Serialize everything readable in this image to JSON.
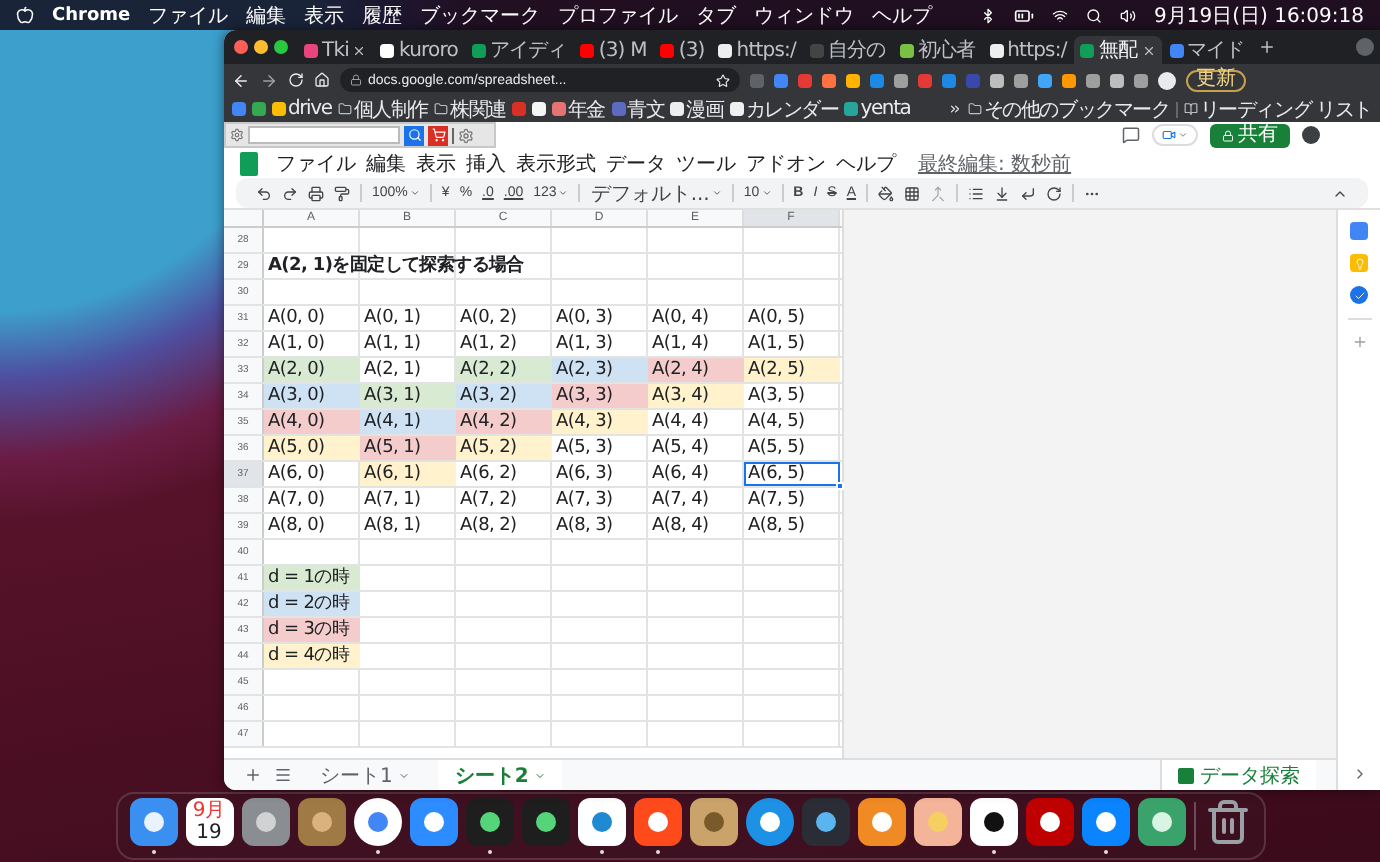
{
  "menubar": {
    "app": "Chrome",
    "menus": [
      "ファイル",
      "編集",
      "表示",
      "履歴",
      "ブックマーク",
      "プロファイル",
      "タブ",
      "ウィンドウ",
      "ヘルプ"
    ],
    "clock": "9月19日(日) 16:09:18"
  },
  "browser": {
    "tabs": [
      {
        "title": "Tki",
        "selected": false,
        "closable": true,
        "color": "#e8457c"
      },
      {
        "title": "kuroro",
        "selected": false,
        "closable": false,
        "color": "#ffffff"
      },
      {
        "title": "アイディ",
        "selected": false,
        "closable": false,
        "color": "#0f9d58"
      },
      {
        "title": "(3) M",
        "selected": false,
        "closable": false,
        "color": "#ff0000"
      },
      {
        "title": "(3)",
        "selected": false,
        "closable": false,
        "color": "#ff0000"
      },
      {
        "title": "https:/",
        "selected": false,
        "closable": false,
        "color": "#eeeeee"
      },
      {
        "title": "自分の",
        "selected": false,
        "closable": false,
        "color": "#444444"
      },
      {
        "title": "初心者",
        "selected": false,
        "closable": false,
        "color": "#7ac143"
      },
      {
        "title": "https:/",
        "selected": false,
        "closable": false,
        "color": "#eeeeee"
      },
      {
        "title": "無配",
        "selected": true,
        "closable": true,
        "color": "#0f9d58"
      },
      {
        "title": "マイド",
        "selected": false,
        "closable": false,
        "color": "#4285f4"
      }
    ],
    "address": "docs.google.com/spreadsheet...",
    "update_button": "更新",
    "bookmarks": [
      {
        "kind": "icon",
        "color": "#4285f4"
      },
      {
        "kind": "icon",
        "color": "#34a853"
      },
      {
        "kind": "link",
        "label": "drive",
        "color": "#fbbc04"
      },
      {
        "kind": "folder",
        "label": "個人制作"
      },
      {
        "kind": "folder",
        "label": "株関連"
      },
      {
        "kind": "icon",
        "color": "#d93025"
      },
      {
        "kind": "icon",
        "color": "#f5f5f5"
      },
      {
        "kind": "link",
        "label": "年金",
        "color": "#e57373"
      },
      {
        "kind": "link",
        "label": "青文",
        "color": "#5c6bc0"
      },
      {
        "kind": "link",
        "label": "漫画",
        "color": "#eeeeee"
      },
      {
        "kind": "link",
        "label": "カレンダー",
        "color": "#f0f0f0"
      },
      {
        "kind": "link",
        "label": "yenta",
        "color": "#26a69a"
      }
    ],
    "other_bookmarks": "その他のブックマーク",
    "reading_list": "リーディング リスト"
  },
  "sheet": {
    "menus": [
      "ファイル",
      "編集",
      "表示",
      "挿入",
      "表示形式",
      "データ",
      "ツール",
      "アドオン",
      "ヘルプ"
    ],
    "last_edit": "最終編集: 数秒前",
    "share_button": "共有",
    "toolbar": {
      "zoom": "100%",
      "currency": "¥",
      "percent": "%",
      "decrease_decimals": ".0",
      "increase_decimals": ".00",
      "number_format": "123",
      "font": "デフォルト...",
      "font_size": "10",
      "bold": "B",
      "italic": "I",
      "strikethrough": "S",
      "text_color": "A"
    },
    "columns": [
      "A",
      "B",
      "C",
      "D",
      "E",
      "F"
    ],
    "rows": [
      {
        "number": "28"
      },
      {
        "number": "29",
        "cells": [
          {
            "text": "A(2, 1)を固定して探索する場合",
            "bold": true,
            "selected": false
          }
        ]
      },
      {
        "number": "30"
      },
      {
        "number": "31",
        "cells": [
          {
            "text": "A(0, 0)",
            "selected": false
          },
          {
            "text": "A(0, 1)",
            "selected": false
          },
          {
            "text": "A(0, 2)",
            "selected": false
          },
          {
            "text": "A(0, 3)",
            "selected": false
          },
          {
            "text": "A(0, 4)",
            "selected": false
          },
          {
            "text": "A(0, 5)",
            "selected": false
          }
        ]
      },
      {
        "number": "32",
        "cells": [
          {
            "text": "A(1, 0)",
            "selected": false
          },
          {
            "text": "A(1, 1)",
            "selected": false
          },
          {
            "text": "A(1, 2)",
            "selected": false
          },
          {
            "text": "A(1, 3)",
            "selected": false
          },
          {
            "text": "A(1, 4)",
            "selected": false
          },
          {
            "text": "A(1, 5)",
            "selected": false
          }
        ]
      },
      {
        "number": "33",
        "cells": [
          {
            "text": "A(2, 0)",
            "color": "#d9ead3",
            "selected": false
          },
          {
            "text": "A(2, 1)",
            "selected": false
          },
          {
            "text": "A(2, 2)",
            "color": "#d9ead3",
            "selected": false
          },
          {
            "text": "A(2, 3)",
            "color": "#cfe2f3",
            "selected": false
          },
          {
            "text": "A(2, 4)",
            "color": "#f4cccc",
            "selected": false
          },
          {
            "text": "A(2, 5)",
            "color": "#fff2cc",
            "selected": false
          }
        ]
      },
      {
        "number": "34",
        "cells": [
          {
            "text": "A(3, 0)",
            "color": "#cfe2f3",
            "selected": false
          },
          {
            "text": "A(3, 1)",
            "color": "#d9ead3",
            "selected": false
          },
          {
            "text": "A(3, 2)",
            "color": "#cfe2f3",
            "selected": false
          },
          {
            "text": "A(3, 3)",
            "color": "#f4cccc",
            "selected": false
          },
          {
            "text": "A(3, 4)",
            "color": "#fff2cc",
            "selected": false
          },
          {
            "text": "A(3, 5)",
            "selected": false
          }
        ]
      },
      {
        "number": "35",
        "cells": [
          {
            "text": "A(4, 0)",
            "color": "#f4cccc",
            "selected": false
          },
          {
            "text": "A(4, 1)",
            "color": "#cfe2f3",
            "selected": false
          },
          {
            "text": "A(4, 2)",
            "color": "#f4cccc",
            "selected": false
          },
          {
            "text": "A(4, 3)",
            "color": "#fff2cc",
            "selected": false
          },
          {
            "text": "A(4, 4)",
            "selected": false
          },
          {
            "text": "A(4, 5)",
            "selected": false
          }
        ]
      },
      {
        "number": "36",
        "cells": [
          {
            "text": "A(5, 0)",
            "color": "#fff2cc",
            "selected": false
          },
          {
            "text": "A(5, 1)",
            "color": "#f4cccc",
            "selected": false
          },
          {
            "text": "A(5, 2)",
            "color": "#fff2cc",
            "selected": false
          },
          {
            "text": "A(5, 3)",
            "selected": false
          },
          {
            "text": "A(5, 4)",
            "selected": false
          },
          {
            "text": "A(5, 5)",
            "selected": false
          }
        ]
      },
      {
        "number": "37",
        "cells": [
          {
            "text": "A(6, 0)",
            "selected": false
          },
          {
            "text": "A(6, 1)",
            "color": "#fff2cc",
            "selected": false
          },
          {
            "text": "A(6, 2)",
            "selected": false
          },
          {
            "text": "A(6, 3)",
            "selected": false
          },
          {
            "text": "A(6, 4)",
            "selected": false
          },
          {
            "text": "A(6, 5)",
            "selected": true
          }
        ]
      },
      {
        "number": "38",
        "cells": [
          {
            "text": "A(7, 0)",
            "selected": false
          },
          {
            "text": "A(7, 1)",
            "selected": false
          },
          {
            "text": "A(7, 2)",
            "selected": false
          },
          {
            "text": "A(7, 3)",
            "selected": false
          },
          {
            "text": "A(7, 4)",
            "selected": false
          },
          {
            "text": "A(7, 5)",
            "selected": false
          }
        ]
      },
      {
        "number": "39",
        "cells": [
          {
            "text": "A(8, 0)",
            "selected": false
          },
          {
            "text": "A(8, 1)",
            "selected": false
          },
          {
            "text": "A(8, 2)",
            "selected": false
          },
          {
            "text": "A(8, 3)",
            "selected": false
          },
          {
            "text": "A(8, 4)",
            "selected": false
          },
          {
            "text": "A(8, 5)",
            "selected": false
          }
        ]
      },
      {
        "number": "40"
      },
      {
        "number": "41",
        "cells": [
          {
            "text": "d = 1の時",
            "color": "#d9ead3",
            "selected": false
          }
        ]
      },
      {
        "number": "42",
        "cells": [
          {
            "text": "d = 2の時",
            "color": "#cfe2f3",
            "selected": false
          }
        ]
      },
      {
        "number": "43",
        "cells": [
          {
            "text": "d = 3の時",
            "color": "#f4cccc",
            "selected": false
          }
        ]
      },
      {
        "number": "44",
        "cells": [
          {
            "text": "d = 4の時",
            "color": "#fff2cc",
            "selected": false
          }
        ]
      },
      {
        "number": "45"
      },
      {
        "number": "46"
      },
      {
        "number": "47"
      }
    ],
    "sheet_tabs": [
      {
        "label": "シート1",
        "selected": false
      },
      {
        "label": "シート2",
        "selected": true
      }
    ],
    "explore_button": "データ探索"
  },
  "dock": [
    {
      "kind": "finder",
      "running": true
    },
    {
      "kind": "calendar",
      "month": "9月",
      "day": "19",
      "running": false
    },
    {
      "kind": "system",
      "running": false
    },
    {
      "kind": "contacts",
      "running": false
    },
    {
      "kind": "chrome",
      "running": true
    },
    {
      "kind": "zoom",
      "running": false
    },
    {
      "kind": "terminal",
      "running": true
    },
    {
      "kind": "terminal",
      "running": false
    },
    {
      "kind": "vscode",
      "running": true
    },
    {
      "kind": "chart",
      "running": true
    },
    {
      "kind": "archive",
      "running": false
    },
    {
      "kind": "docker",
      "running": false
    },
    {
      "kind": "quicktime",
      "running": false
    },
    {
      "kind": "flow",
      "running": false
    },
    {
      "kind": "pill",
      "running": false
    },
    {
      "kind": "notion",
      "running": true
    },
    {
      "kind": "filezilla",
      "running": false
    },
    {
      "kind": "infinity",
      "running": true
    },
    {
      "kind": "diamond",
      "running": false
    },
    {
      "kind": "trash",
      "running": false
    }
  ]
}
